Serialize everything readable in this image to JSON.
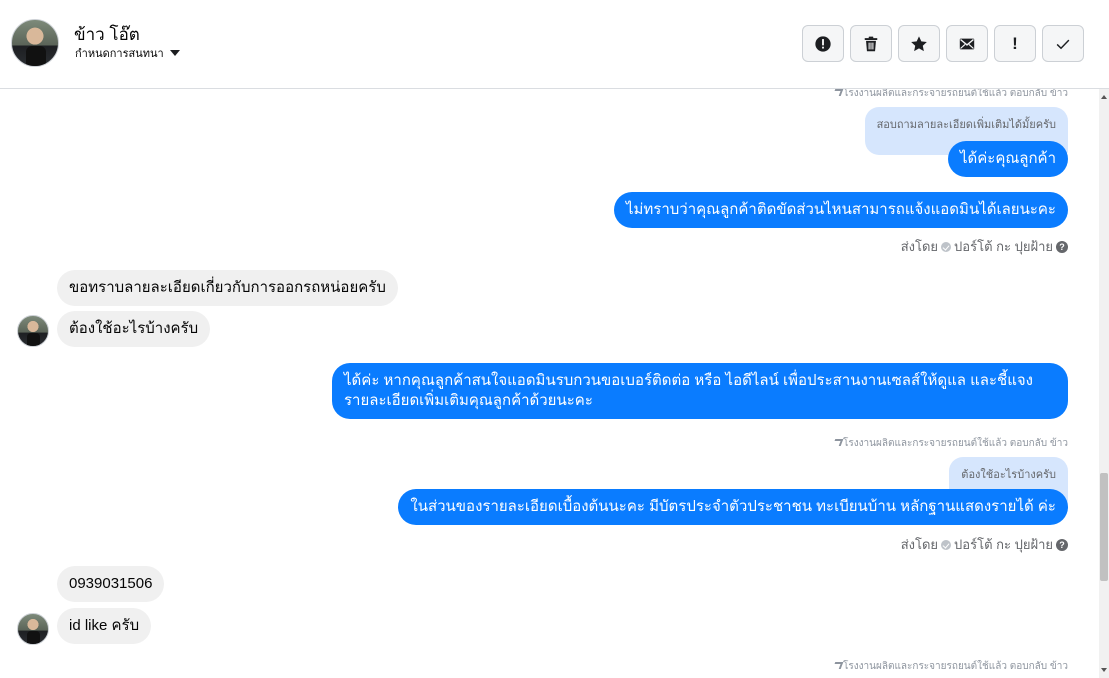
{
  "header": {
    "contact_name": "ข้าว โอ๊ต",
    "assign_label": "กำหนดการสนทนา"
  },
  "toolbar": {
    "buttons": [
      {
        "icon": "alert-circle-icon",
        "name": "mark-spam-button"
      },
      {
        "icon": "trash-icon",
        "name": "delete-button"
      },
      {
        "icon": "star-icon",
        "name": "star-button"
      },
      {
        "icon": "envelope-icon",
        "name": "mark-unread-button"
      },
      {
        "icon": "exclamation-icon",
        "name": "priority-button",
        "glyph": "!"
      },
      {
        "icon": "check-icon",
        "name": "done-button"
      }
    ]
  },
  "messages": {
    "meta_1": "โรงงานผลิตและกระจายรถยนต์ใช้แล้ว ตอบกลับ ข้าว",
    "reply_q1": "สอบถามลายละเอียดเพิ่มเติมได้มั้ยครับ",
    "out_1": "ได้ค่ะคุณลูกค้า",
    "out_2": "ไม่ทราบว่าคุณลูกค้าติดขัดส่วนไหนสามารถแจ้งแอดมินได้เลยนะคะ",
    "sent_by_1": "ส่งโดย",
    "sender_1": "ปอร์โต้ กะ ปุยฝ้าย",
    "in_1": "ขอทราบลายละเอียดเกี่ยวกับการออกรถหน่อยครับ",
    "in_2": "ต้องใช้อะไรบ้างครับ",
    "out_3": "ได้ค่ะ หากคุณลูกค้าสนใจแอดมินรบกวนขอเบอร์ติดต่อ หรือ ไอดีไลน์ เพื่อประสานงานเซลส์ให้ดูแล และชี้แจงรายละเอียดเพิ่มเติมคุณลูกค้าด้วยนะคะ",
    "meta_2": "โรงงานผลิตและกระจายรถยนต์ใช้แล้ว ตอบกลับ ข้าว",
    "reply_q2": "ต้องใช้อะไรบ้างครับ",
    "out_4": "ในส่วนของรายละเอียดเบื้องต้นนะคะ มีบัตรประจำตัวประชาชน ทะเบียนบ้าน หลักฐานแสดงรายได้ ค่ะ",
    "sent_by_2": "ส่งโดย",
    "sender_2": "ปอร์โต้ กะ ปุยฝ้าย",
    "in_3": "0939031506",
    "in_4": "id like ครับ",
    "meta_3": "โรงงานผลิตและกระจายรถยนต์ใช้แล้ว ตอบกลับ ข้าว"
  }
}
